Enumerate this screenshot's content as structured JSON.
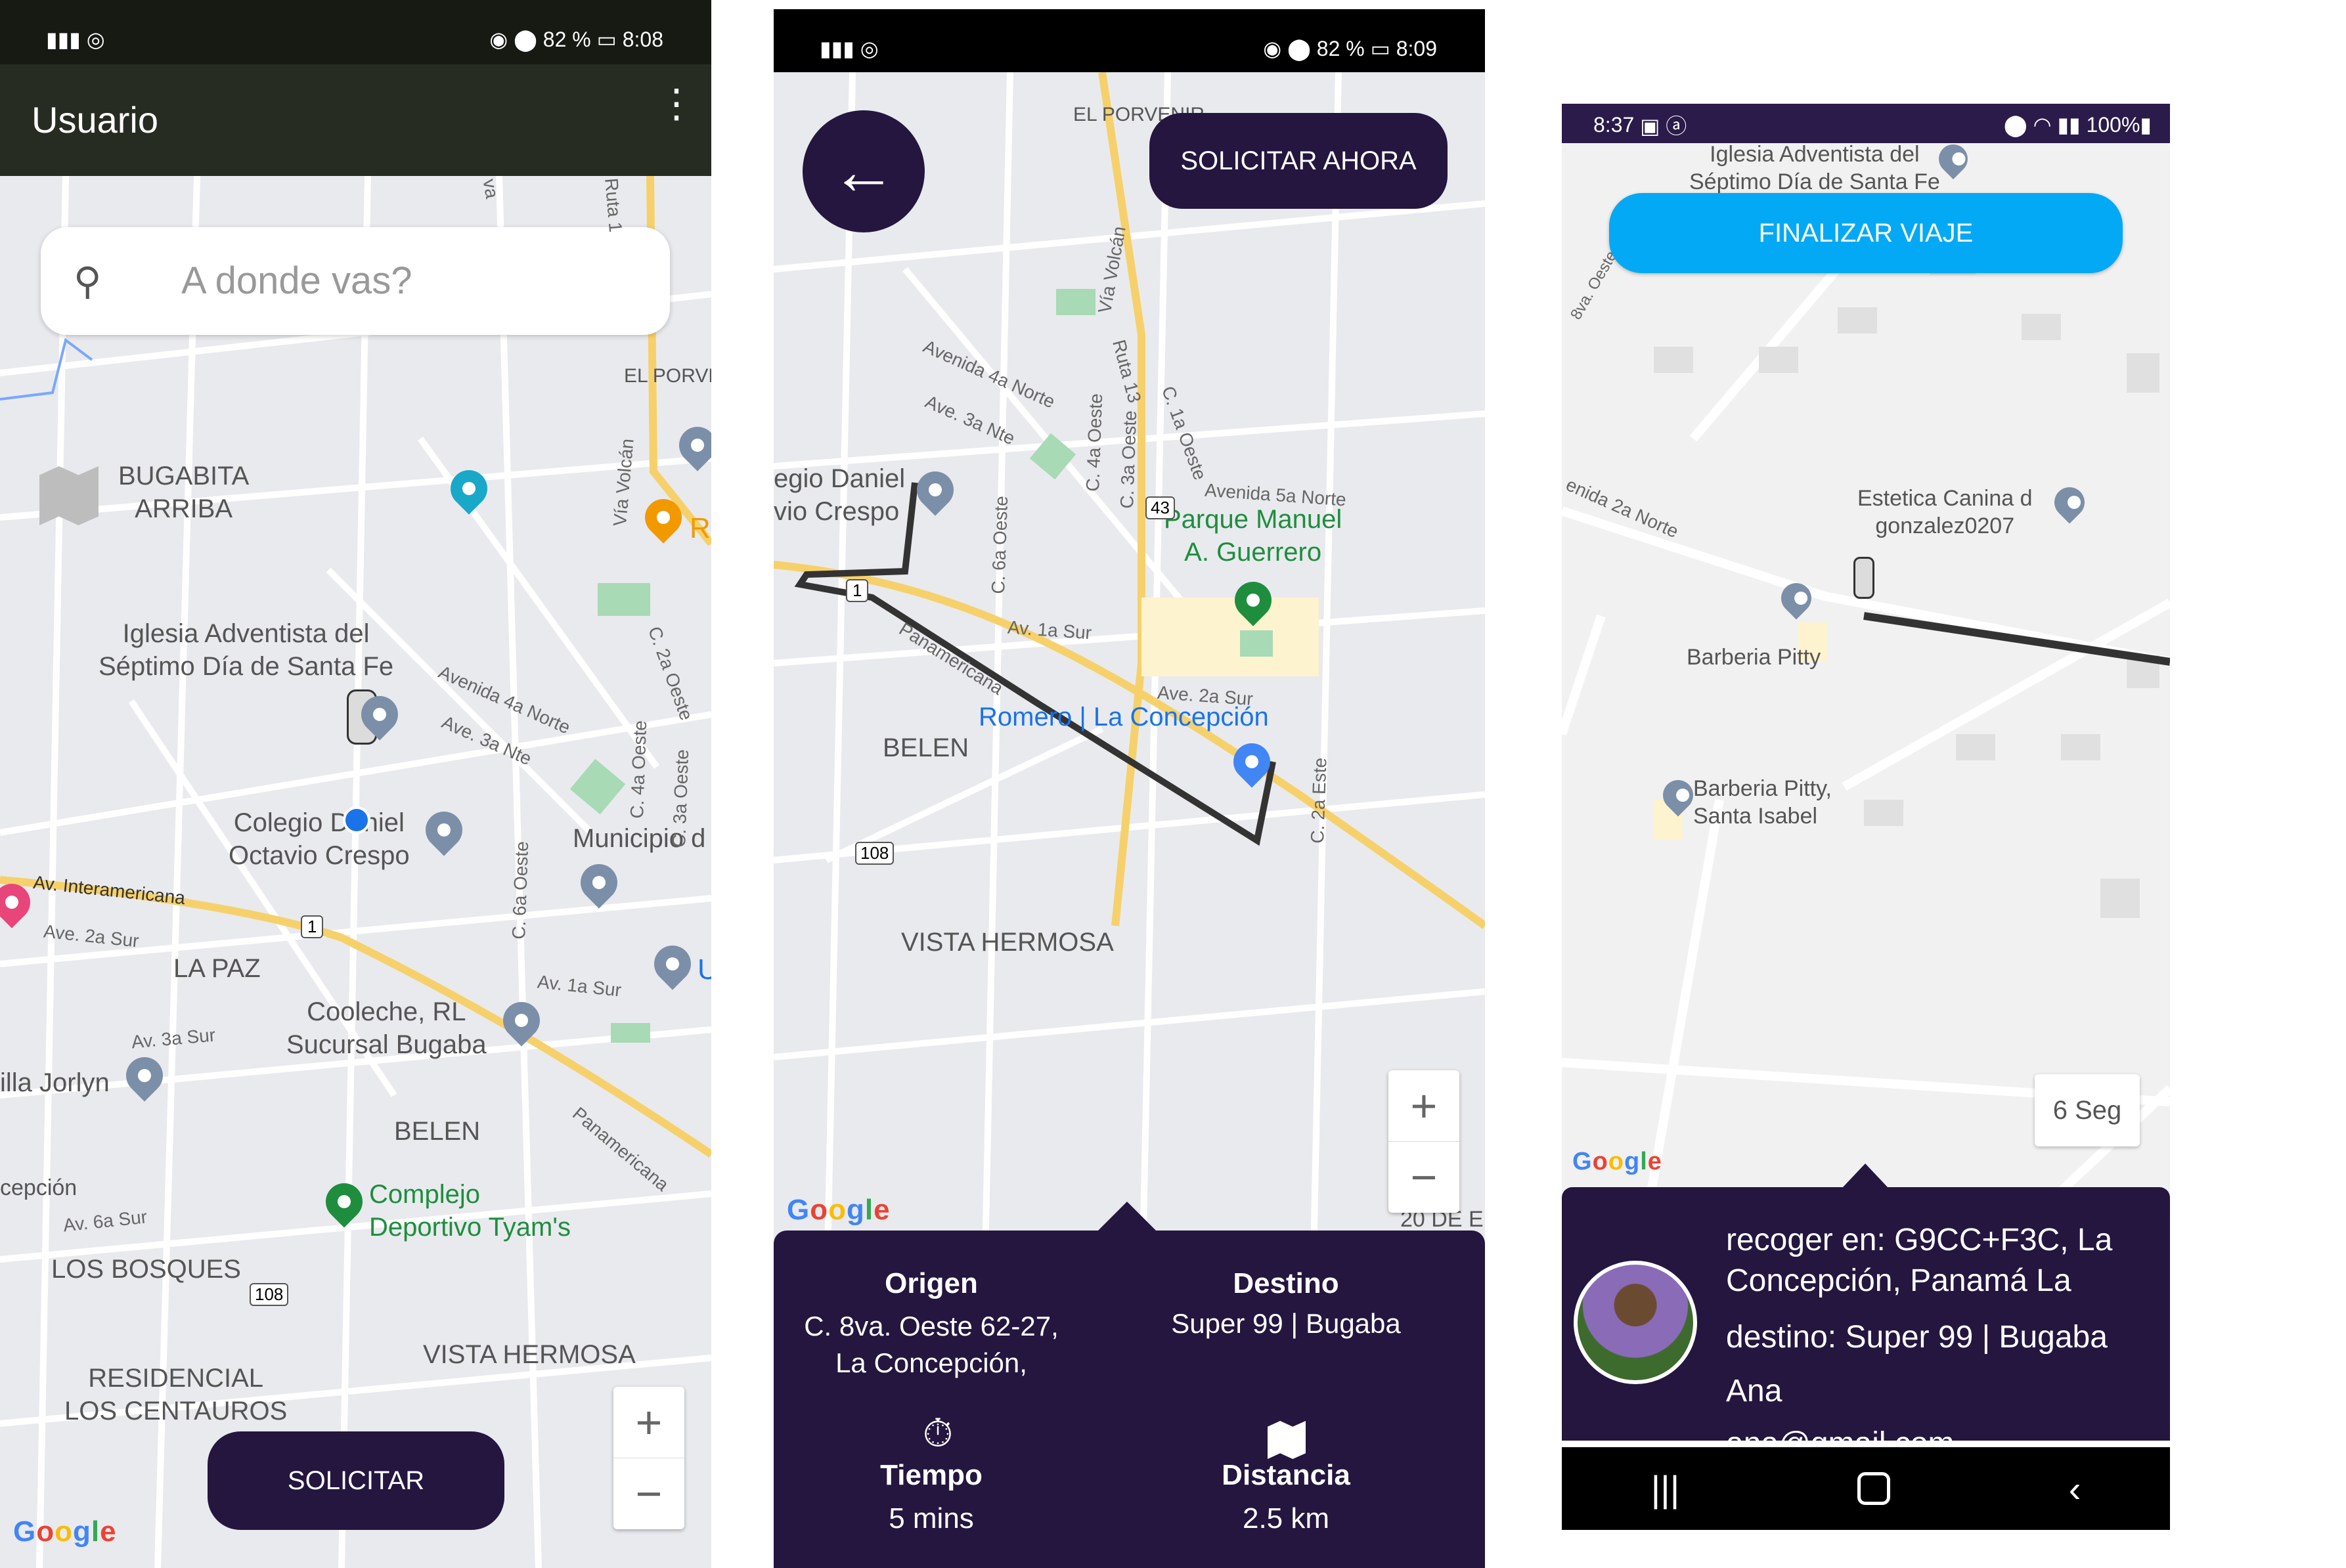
{
  "screen1": {
    "status": {
      "time": "8:08",
      "battery": "82 %"
    },
    "appbar": {
      "title": "Usuario"
    },
    "search": {
      "placeholder": "A donde vas?"
    },
    "map_labels": {
      "bugabita": "BUGABITA\nARRIBA",
      "iglesia": "Iglesia Adventista del\nSéptimo Día de Santa Fe",
      "colegio": "Colegio Daniel\nOctavio Crespo",
      "la_paz": "LA PAZ",
      "cooleche": "Cooleche, RL\nSucursal Bugaba",
      "villa": "illa Jorlyn",
      "belen": "BELEN",
      "complejo": "Complejo\nDeportivo Tyam's",
      "concepcion": "cepción",
      "los_bosques": "LOS BOSQUES",
      "residencial": "RESIDENCIAL\nLOS CENTAUROS",
      "vista": "VISTA HERMOSA",
      "municipio": "Municipio d",
      "el_porve": "EL PORVE",
      "r": "R",
      "u": "U",
      "av_interamericana": "Av. Interamericana",
      "av_2a_sur": "Ave. 2a Sur",
      "av_1a_sur": "Av. 1a Sur",
      "av_3a_sur": "Av. 3a Sur",
      "av_6a_sur": "Av. 6a Sur",
      "avenida_4a": "Avenida 4a Norte",
      "ave_3a_nte": "Ave. 3a Nte",
      "via_volcan": "Vía Volcán",
      "ruta1": "Ruta 1",
      "c2a_oeste": "C. 2a Oeste",
      "c4a_oeste": "C. 4a Oeste",
      "c3a_oeste": "C. 3a Oeste",
      "c6a_oeste": "C. 6a Oeste",
      "panamericana": "Panamericana",
      "shield1": "1",
      "shield108": "108",
      "va": "va"
    },
    "zoom": {
      "in": "+",
      "out": "−"
    },
    "button": "SOLICITAR",
    "google": [
      "G",
      "o",
      "o",
      "g",
      "l",
      "e"
    ]
  },
  "screen2": {
    "status": {
      "time": "8:09",
      "battery": "82 %"
    },
    "button": "SOLICITAR AHORA",
    "map_labels": {
      "el_porvenir": "EL PORVENIR",
      "colegio": "egio Daniel\nvio Crespo",
      "parque": "Parque Manuel\nA. Guerrero",
      "romero": "Romero | La Concepción",
      "belen": "BELEN",
      "vista": "VISTA HERMOSA",
      "via_volcan": "Vía Volcán",
      "ruta13": "Ruta 13",
      "c1a_oeste": "C. 1a Oeste",
      "c4a_oeste": "C. 4a Oeste",
      "c3a_oeste": "C. 3a Oeste",
      "c6a_oeste": "C. 6a Oeste",
      "c2a_este": "C. 2a Este",
      "avenida_4a": "Avenida 4a Norte",
      "ave_3a_nte": "Ave. 3a Nte",
      "avenida_5a": "Avenida 5a Norte",
      "av_1a_sur": "Av. 1a Sur",
      "ave_2a_sur": "Ave. 2a Sur",
      "panamericana": "Panamericana",
      "shield43": "43",
      "shield1": "1",
      "shield108": "108",
      "de": "20 DE E"
    },
    "zoom": {
      "in": "+",
      "out": "−"
    },
    "google": [
      "G",
      "o",
      "o",
      "g",
      "l",
      "e"
    ],
    "info": {
      "origin_title": "Origen",
      "origin_value": "C. 8va. Oeste 62-27,\nLa Concepción,",
      "dest_title": "Destino",
      "dest_value": "Super 99 | Bugaba",
      "time_title": "Tiempo",
      "time_value": "5 mins",
      "distance_title": "Distancia",
      "distance_value": "2.5 km"
    }
  },
  "screen3": {
    "status": {
      "time": "8:37",
      "battery": "100%"
    },
    "button": "FINALIZAR VIAJE",
    "map_labels": {
      "iglesia": "Iglesia Adventista del\nSéptimo Día de Santa Fe",
      "estetica": "Estetica Canina d\ngonzalez0207",
      "barberia": "Barberia Pitty",
      "barberia2": "Barberia Pitty,\nSanta Isabel",
      "avenida_2a": "enida 2a Norte",
      "oeste": "8va. Oeste"
    },
    "timer": "6 Seg",
    "google": [
      "G",
      "o",
      "o",
      "g",
      "l",
      "e"
    ],
    "info": {
      "pickup": "recoger en: G9CC+F3C, La\nConcepción, Panamá La",
      "destination": "destino: Super 99 | Bugaba",
      "name": "Ana",
      "email": "ana@gmail.com"
    }
  },
  "colors": {
    "app_dark": "#24163f",
    "appbar": "#262c22",
    "finalizar": "#03a9f4"
  }
}
